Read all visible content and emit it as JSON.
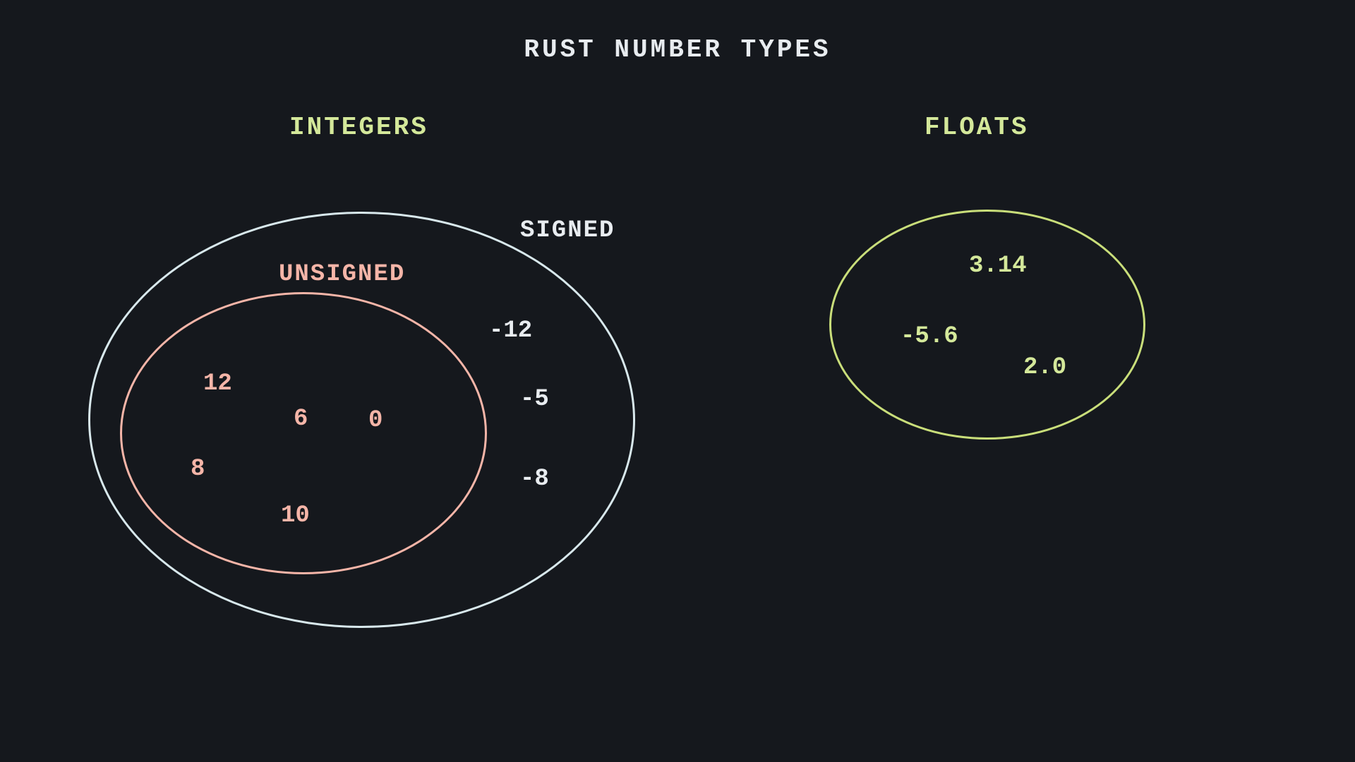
{
  "title": "RUST NUMBER TYPES",
  "sections": {
    "integers": {
      "label": "INTEGERS",
      "signed": {
        "label": "SIGNED",
        "values": [
          "-12",
          "-5",
          "-8"
        ]
      },
      "unsigned": {
        "label": "UNSIGNED",
        "values": [
          "12",
          "6",
          "0",
          "8",
          "10"
        ]
      }
    },
    "floats": {
      "label": "FLOATS",
      "values": [
        "3.14",
        "-5.6",
        "2.0"
      ]
    }
  },
  "colors": {
    "background": "#15181d",
    "title": "#e8ecf0",
    "section_label": "#d4e89a",
    "signed": "#d8e8ec",
    "unsigned": "#f5b5a8",
    "floats_ellipse": "#c9de7a",
    "float_text": "#d4e89a"
  }
}
